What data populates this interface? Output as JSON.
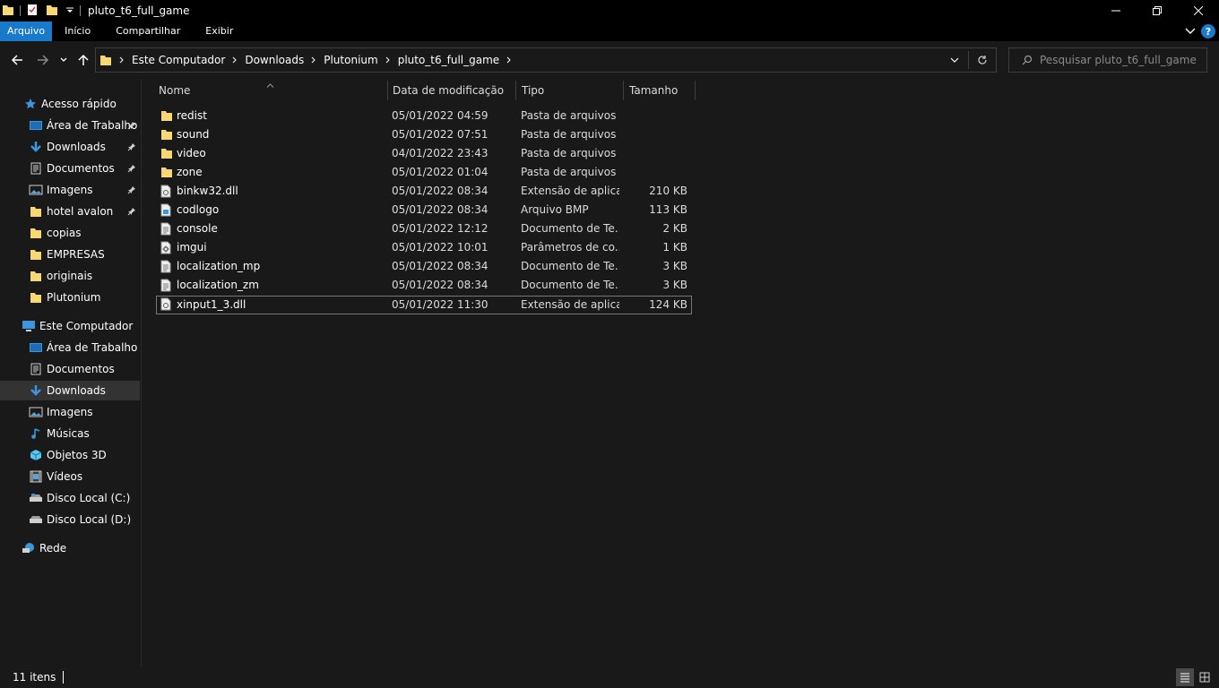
{
  "window": {
    "title": "pluto_t6_full_game"
  },
  "ribbon": {
    "tabs": [
      {
        "label": "Arquivo"
      },
      {
        "label": "Início"
      },
      {
        "label": "Compartilhar"
      },
      {
        "label": "Exibir"
      }
    ],
    "help_label": "?"
  },
  "address": {
    "crumbs": [
      "Este Computador",
      "Downloads",
      "Plutonium",
      "pluto_t6_full_game"
    ]
  },
  "search": {
    "placeholder": "Pesquisar pluto_t6_full_game"
  },
  "sidebar": {
    "quick_access": {
      "label": "Acesso rápido",
      "items": [
        {
          "label": "Área de Trabalho",
          "icon": "desktop-icon",
          "pinned": true
        },
        {
          "label": "Downloads",
          "icon": "download-icon",
          "pinned": true
        },
        {
          "label": "Documentos",
          "icon": "document-icon",
          "pinned": true
        },
        {
          "label": "Imagens",
          "icon": "pictures-icon",
          "pinned": true
        },
        {
          "label": "hotel avalon",
          "icon": "folder-icon",
          "pinned": true
        },
        {
          "label": "copias",
          "icon": "folder-icon",
          "pinned": false
        },
        {
          "label": "EMPRESAS",
          "icon": "folder-icon",
          "pinned": false
        },
        {
          "label": "originais",
          "icon": "folder-icon",
          "pinned": false
        },
        {
          "label": "Plutonium",
          "icon": "folder-icon",
          "pinned": false
        }
      ]
    },
    "this_pc": {
      "label": "Este Computador",
      "items": [
        {
          "label": "Área de Trabalho",
          "icon": "desktop-icon"
        },
        {
          "label": "Documentos",
          "icon": "document-icon"
        },
        {
          "label": "Downloads",
          "icon": "download-icon",
          "selected": true
        },
        {
          "label": "Imagens",
          "icon": "pictures-icon"
        },
        {
          "label": "Músicas",
          "icon": "music-icon"
        },
        {
          "label": "Objetos 3D",
          "icon": "cube-icon"
        },
        {
          "label": "Vídeos",
          "icon": "video-icon"
        },
        {
          "label": "Disco Local (C:)",
          "icon": "drive-icon"
        },
        {
          "label": "Disco Local (D:)",
          "icon": "drive-icon"
        }
      ]
    },
    "network": {
      "label": "Rede"
    }
  },
  "columns": {
    "name": "Nome",
    "date": "Data de modificação",
    "type": "Tipo",
    "size": "Tamanho"
  },
  "files": [
    {
      "name": "redist",
      "date": "05/01/2022 04:59",
      "type": "Pasta de arquivos",
      "size": "",
      "icon": "folder-icon"
    },
    {
      "name": "sound",
      "date": "05/01/2022 07:51",
      "type": "Pasta de arquivos",
      "size": "",
      "icon": "folder-icon"
    },
    {
      "name": "video",
      "date": "04/01/2022 23:43",
      "type": "Pasta de arquivos",
      "size": "",
      "icon": "folder-icon"
    },
    {
      "name": "zone",
      "date": "05/01/2022 01:04",
      "type": "Pasta de arquivos",
      "size": "",
      "icon": "folder-icon"
    },
    {
      "name": "binkw32.dll",
      "date": "05/01/2022 08:34",
      "type": "Extensão de aplica...",
      "size": "210 KB",
      "icon": "dll-icon"
    },
    {
      "name": "codlogo",
      "date": "05/01/2022 08:34",
      "type": "Arquivo BMP",
      "size": "113 KB",
      "icon": "image-file-icon"
    },
    {
      "name": "console",
      "date": "05/01/2022 12:12",
      "type": "Documento de Te...",
      "size": "2 KB",
      "icon": "text-file-icon"
    },
    {
      "name": "imgui",
      "date": "05/01/2022 10:01",
      "type": "Parâmetros de co...",
      "size": "1 KB",
      "icon": "settings-file-icon"
    },
    {
      "name": "localization_mp",
      "date": "05/01/2022 08:34",
      "type": "Documento de Te...",
      "size": "3 KB",
      "icon": "text-file-icon"
    },
    {
      "name": "localization_zm",
      "date": "05/01/2022 08:34",
      "type": "Documento de Te...",
      "size": "3 KB",
      "icon": "text-file-icon"
    },
    {
      "name": "xinput1_3.dll",
      "date": "05/01/2022 11:30",
      "type": "Extensão de aplica...",
      "size": "124 KB",
      "icon": "dll-icon",
      "selected": true
    }
  ],
  "status": {
    "item_count": "11 itens"
  },
  "colors": {
    "accent": "#1979ca",
    "folder": "#f8d775",
    "background": "#191919",
    "titlebar": "#000000"
  }
}
